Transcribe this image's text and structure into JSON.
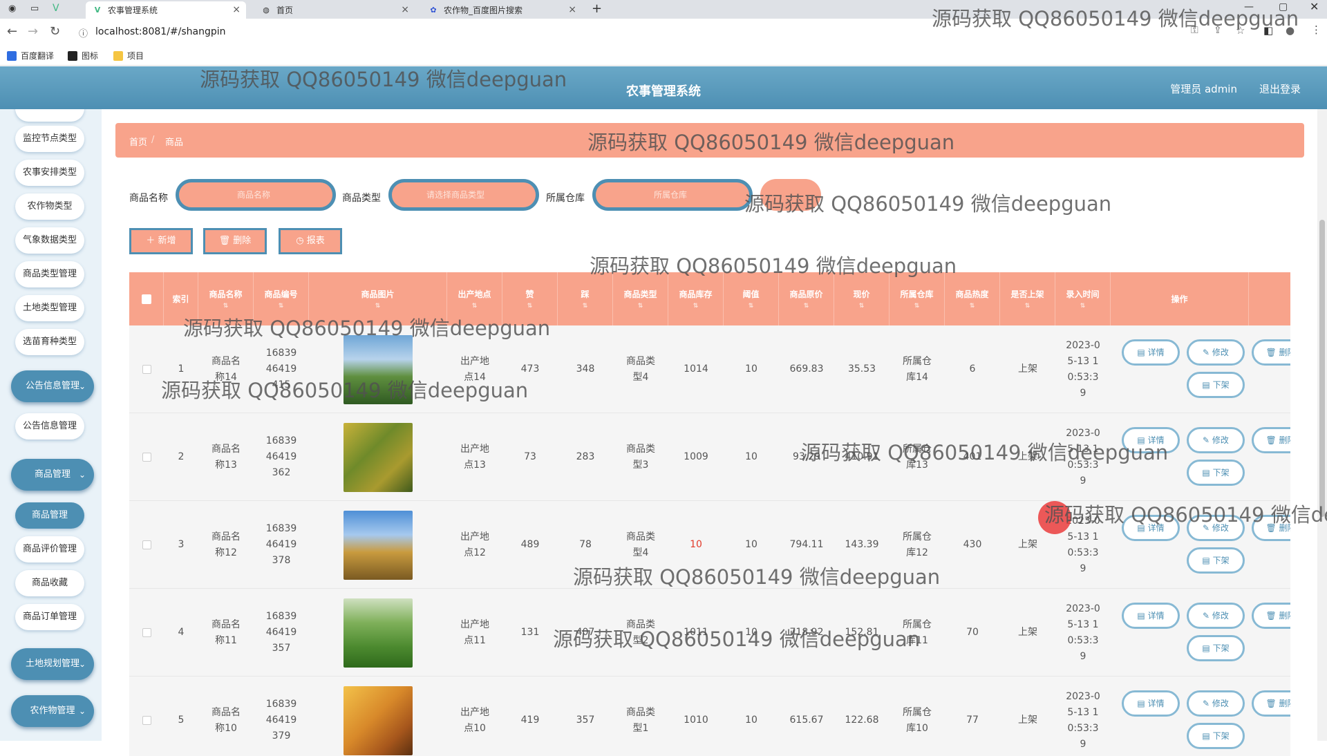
{
  "browser": {
    "tabs": [
      {
        "title": "农事管理系统",
        "active": true
      },
      {
        "title": "首页",
        "active": false
      },
      {
        "title": "农作物_百度图片搜索",
        "active": false
      }
    ],
    "url": "localhost:8081/#/shangpin",
    "bookmarks": [
      "百度翻译",
      "图标",
      "项目"
    ]
  },
  "header": {
    "title": "农事管理系统",
    "admin": "管理员 admin",
    "logout": "退出登录",
    "bg_color": "#4d8fb3"
  },
  "sidebar": {
    "items": [
      {
        "label": "监控节点类型"
      },
      {
        "label": "农事安排类型"
      },
      {
        "label": "农作物类型"
      },
      {
        "label": "气象数据类型"
      },
      {
        "label": "商品类型管理"
      },
      {
        "label": "土地类型管理"
      },
      {
        "label": "选苗育种类型"
      },
      {
        "label": "公告信息管理",
        "group": true
      },
      {
        "label": "公告信息管理"
      },
      {
        "label": "商品管理",
        "group": true
      },
      {
        "label": "商品管理",
        "selected": true
      },
      {
        "label": "商品评价管理"
      },
      {
        "label": "商品收藏"
      },
      {
        "label": "商品订单管理"
      },
      {
        "label": "土地规划管理",
        "group": true
      },
      {
        "label": "农作物管理",
        "group": true
      }
    ]
  },
  "breadcrumb": [
    "首页",
    "商品"
  ],
  "filters": {
    "name_label": "商品名称",
    "name_placeholder": "商品名称",
    "type_label": "商品类型",
    "type_placeholder": "请选择商品类型",
    "warehouse_label": "所属仓库",
    "warehouse_placeholder": "所属仓库"
  },
  "actions": {
    "add": "＋ 新增",
    "delete": "🗑 删除",
    "report": "◷ 报表"
  },
  "table": {
    "headers": [
      "索引",
      "商品名称",
      "商品编号",
      "商品图片",
      "出产地点",
      "赞",
      "踩",
      "商品类型",
      "商品库存",
      "阈值",
      "商品原价",
      "现价",
      "所属仓库",
      "商品热度",
      "是否上架",
      "录入时间",
      "操作"
    ],
    "rows": [
      {
        "idx": "1",
        "name": "商品名称14",
        "code": "1683946419415",
        "origin": "出产地点14",
        "like": "473",
        "dislike": "348",
        "type": "商品类型4",
        "stock": "1014",
        "threshold": "10",
        "orig_price": "669.83",
        "price": "35.53",
        "warehouse": "所属仓库14",
        "heat": "6",
        "onsale": "上架",
        "time": "2023-05-13 10:53:39",
        "stock_alert": false,
        "image": "crop-blue-sky"
      },
      {
        "idx": "2",
        "name": "商品名称13",
        "code": "1683946419362",
        "origin": "出产地点13",
        "like": "73",
        "dislike": "283",
        "type": "商品类型3",
        "stock": "1009",
        "threshold": "10",
        "orig_price": "93.29",
        "price": "410.91",
        "warehouse": "所属仓库13",
        "heat": "401",
        "onsale": "上架",
        "time": "2023-05-13 10:53:39",
        "stock_alert": false,
        "image": "rice-ears"
      },
      {
        "idx": "3",
        "name": "商品名称12",
        "code": "1683946419378",
        "origin": "出产地点12",
        "like": "489",
        "dislike": "78",
        "type": "商品类型4",
        "stock": "10",
        "threshold": "10",
        "orig_price": "794.11",
        "price": "143.39",
        "warehouse": "所属仓库12",
        "heat": "430",
        "onsale": "上架",
        "time": "2023-05-13 10:53:39",
        "stock_alert": true,
        "image": "wheat-sky"
      },
      {
        "idx": "4",
        "name": "商品名称11",
        "code": "1683946419357",
        "origin": "出产地点11",
        "like": "131",
        "dislike": "407",
        "type": "商品类型2",
        "stock": "1011",
        "threshold": "10",
        "orig_price": "718.92",
        "price": "152.81",
        "warehouse": "所属仓库11",
        "heat": "70",
        "onsale": "上架",
        "time": "2023-05-13 10:53:39",
        "stock_alert": false,
        "image": "green-field"
      },
      {
        "idx": "5",
        "name": "商品名称10",
        "code": "1683946419379",
        "origin": "出产地点10",
        "like": "419",
        "dislike": "357",
        "type": "商品类型1",
        "stock": "1010",
        "threshold": "10",
        "orig_price": "615.67",
        "price": "122.68",
        "warehouse": "所属仓库10",
        "heat": "77",
        "onsale": "上架",
        "time": "2023-05-13 10:53:39",
        "stock_alert": false,
        "image": "golden-wheat"
      }
    ],
    "ops": {
      "detail": "详情",
      "edit": "修改",
      "del": "删除",
      "offsale": "下架"
    }
  },
  "watermark": "源码获取 QQ86050149 微信deepguan",
  "colors": {
    "accent": "#f8a38b",
    "primary": "#4d8fb3",
    "alert": "#e23a2a"
  }
}
